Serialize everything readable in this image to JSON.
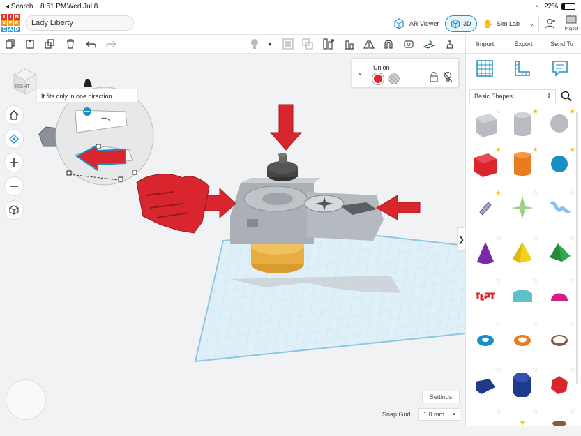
{
  "status": {
    "back": "◂ Search",
    "time": "8:51 PM",
    "date": "Wed Jul 8",
    "battery": "22%"
  },
  "logo": {
    "letters": [
      "T",
      "I",
      "N",
      "K",
      "E",
      "R",
      "C",
      "A",
      "D"
    ],
    "colors": [
      "#e2342e",
      "#e2342e",
      "#e2342e",
      "#f7941e",
      "#f7941e",
      "#f7941e",
      "#2aa4e0",
      "#2aa4e0",
      "#2aa4e0"
    ]
  },
  "header": {
    "project_title": "Lady Liberty",
    "ar_viewer": "AR Viewer",
    "view_3d": "3D",
    "sim_lab": "Sim Lab",
    "project_label": "Project"
  },
  "toolbar": {
    "import": "Import",
    "export": "Export",
    "send_to": "Send To"
  },
  "viewcube": {
    "face": "RIGHT"
  },
  "tooltip": "It fits only in one direction",
  "inspector": {
    "title": "Union",
    "solid_color": "#e0252f"
  },
  "panel": {
    "category": "Basic Shapes",
    "collapse": "❯"
  },
  "settings": "Settings",
  "snap": {
    "label": "Snap Grid",
    "value": "1.0 mm"
  },
  "colors": {
    "accent": "#2a8fbd",
    "red": "#d9262e",
    "grid": "#cfe6f2"
  },
  "icons": [
    "copy-icon",
    "paste-icon",
    "duplicate-icon",
    "delete-icon",
    "undo-icon",
    "redo-icon",
    "light-icon",
    "group-icon",
    "align-icon",
    "mirror-icon",
    "workplane-icon",
    "ruler-icon",
    "notes-icon",
    "home-icon",
    "fit-icon",
    "zoom-in-icon",
    "zoom-out-icon",
    "perspective-icon",
    "search-icon",
    "grid-icon",
    "ruler-panel-icon",
    "notes-panel-icon"
  ]
}
